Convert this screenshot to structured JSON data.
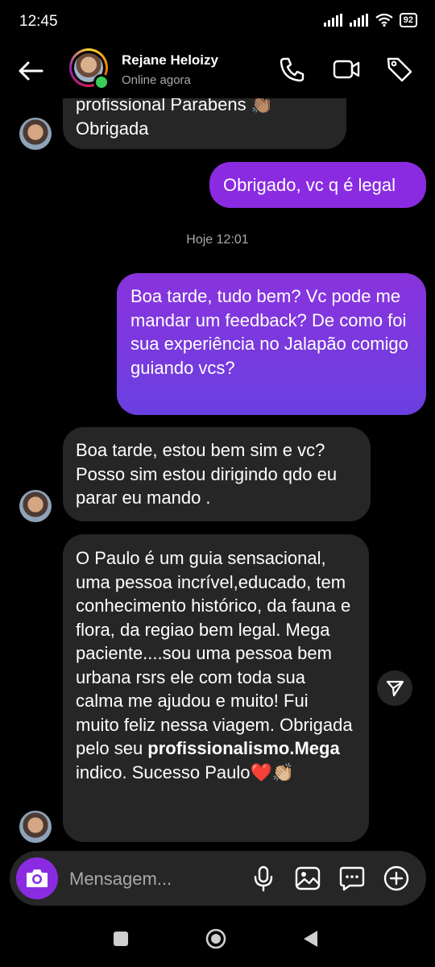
{
  "status_bar": {
    "time": "12:45",
    "battery": "92"
  },
  "header": {
    "contact_name": "Rejane Heloizy",
    "contact_status": "Online agora"
  },
  "messages": [
    {
      "from": "them",
      "lines": [
        "profissional Parabens 👏🏽",
        "Obrigada"
      ]
    },
    {
      "from": "me",
      "text": "Obrigado, vc q é legal"
    },
    {
      "from": "me",
      "text": "Boa tarde, tudo bem? Vc pode me mandar um feedback? De como foi sua experiência no Jalapão comigo guiando vcs?"
    },
    {
      "from": "them",
      "text": "Boa tarde, estou bem sim e vc? Posso sim estou dirigindo qdo eu parar eu mando ."
    },
    {
      "from": "them",
      "text_before": "O Paulo é um guia sensacional, uma pessoa incrível,educado, tem conhecimento histórico, da fauna e flora, da regiao bem legal. Mega paciente....sou uma pessoa bem urbana rsrs ele com toda sua calma me ajudou e muito! Fui muito feliz nessa viagem. Obrigada pelo seu ",
      "text_bold": "profissionalismo.Mega",
      "text_after": " indico. Sucesso Paulo❤️👏🏼"
    }
  ],
  "timestamp": "Hoje 12:01",
  "composer": {
    "placeholder": "Mensagem..."
  },
  "colors": {
    "sent_bubble": "#8a2be2",
    "received_bubble": "#262626",
    "online": "#3ccb5a"
  }
}
